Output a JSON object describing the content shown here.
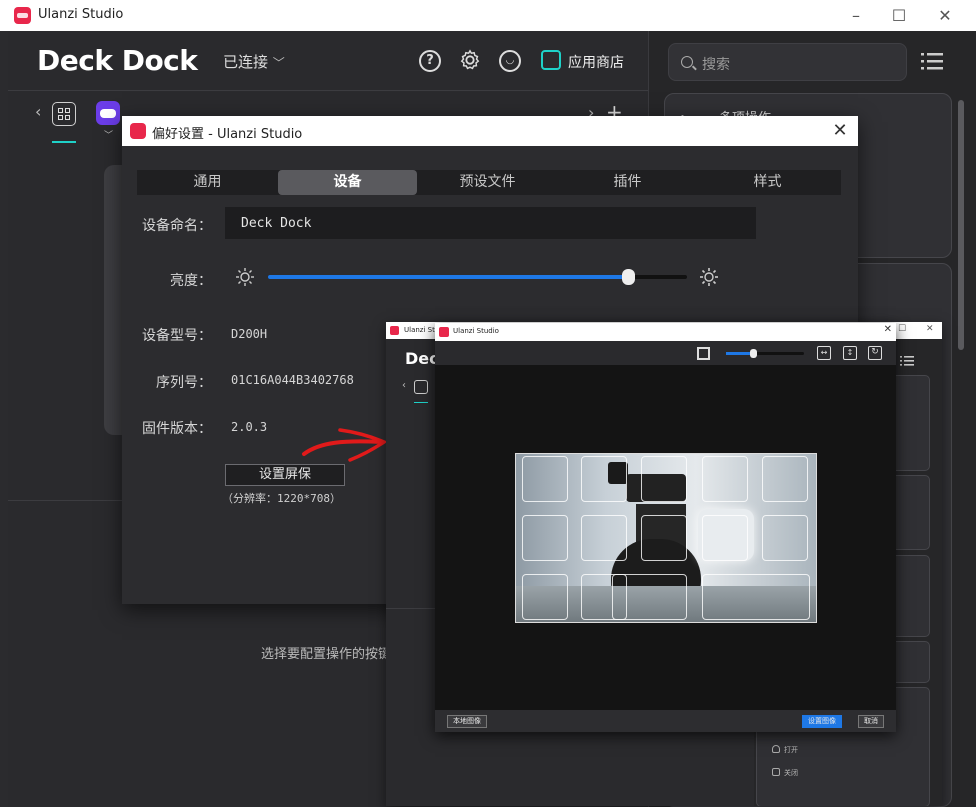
{
  "window": {
    "title": "Ulanzi Studio"
  },
  "header": {
    "brand": "Deck Dock",
    "connection": "已连接",
    "store_label": "应用商店"
  },
  "left": {
    "hint": "选择要配置操作的按键"
  },
  "sidebar": {
    "search_placeholder": "搜索",
    "category_partial": "多项操作",
    "bottom_item": "关闭"
  },
  "preferences": {
    "title": "偏好设置 - Ulanzi Studio",
    "tabs": [
      "通用",
      "设备",
      "预设文件",
      "插件",
      "样式"
    ],
    "active_tab": 1,
    "device_name_label": "设备命名：",
    "device_name_value": "Deck Dock",
    "brightness_label": "亮度：",
    "brightness_percent": 86,
    "model_label": "设备型号：",
    "model_value": "D200H",
    "serial_label": "序列号：",
    "serial_value": "01C16A044B3402768",
    "firmware_label": "固件版本：",
    "firmware_value": "2.0.3",
    "screensaver_button": "设置屏保",
    "resolution": "（分辨率：1220*708）"
  },
  "nested_window": {
    "title_partial": "Ulanzi St",
    "brand_partial": "Dec",
    "sidebar_items": [
      "打开",
      "关闭"
    ]
  },
  "crop_dialog": {
    "title": "Ulanzi Studio",
    "zoom_percent": 35,
    "local_image_button": "本地图像",
    "set_image_button": "设置图像",
    "cancel_button": "取消"
  },
  "colors": {
    "accent_blue": "#1e78e6",
    "teal": "#1fd1c8",
    "brand_red": "#e8274b",
    "annotation_red": "#e11a1a"
  }
}
